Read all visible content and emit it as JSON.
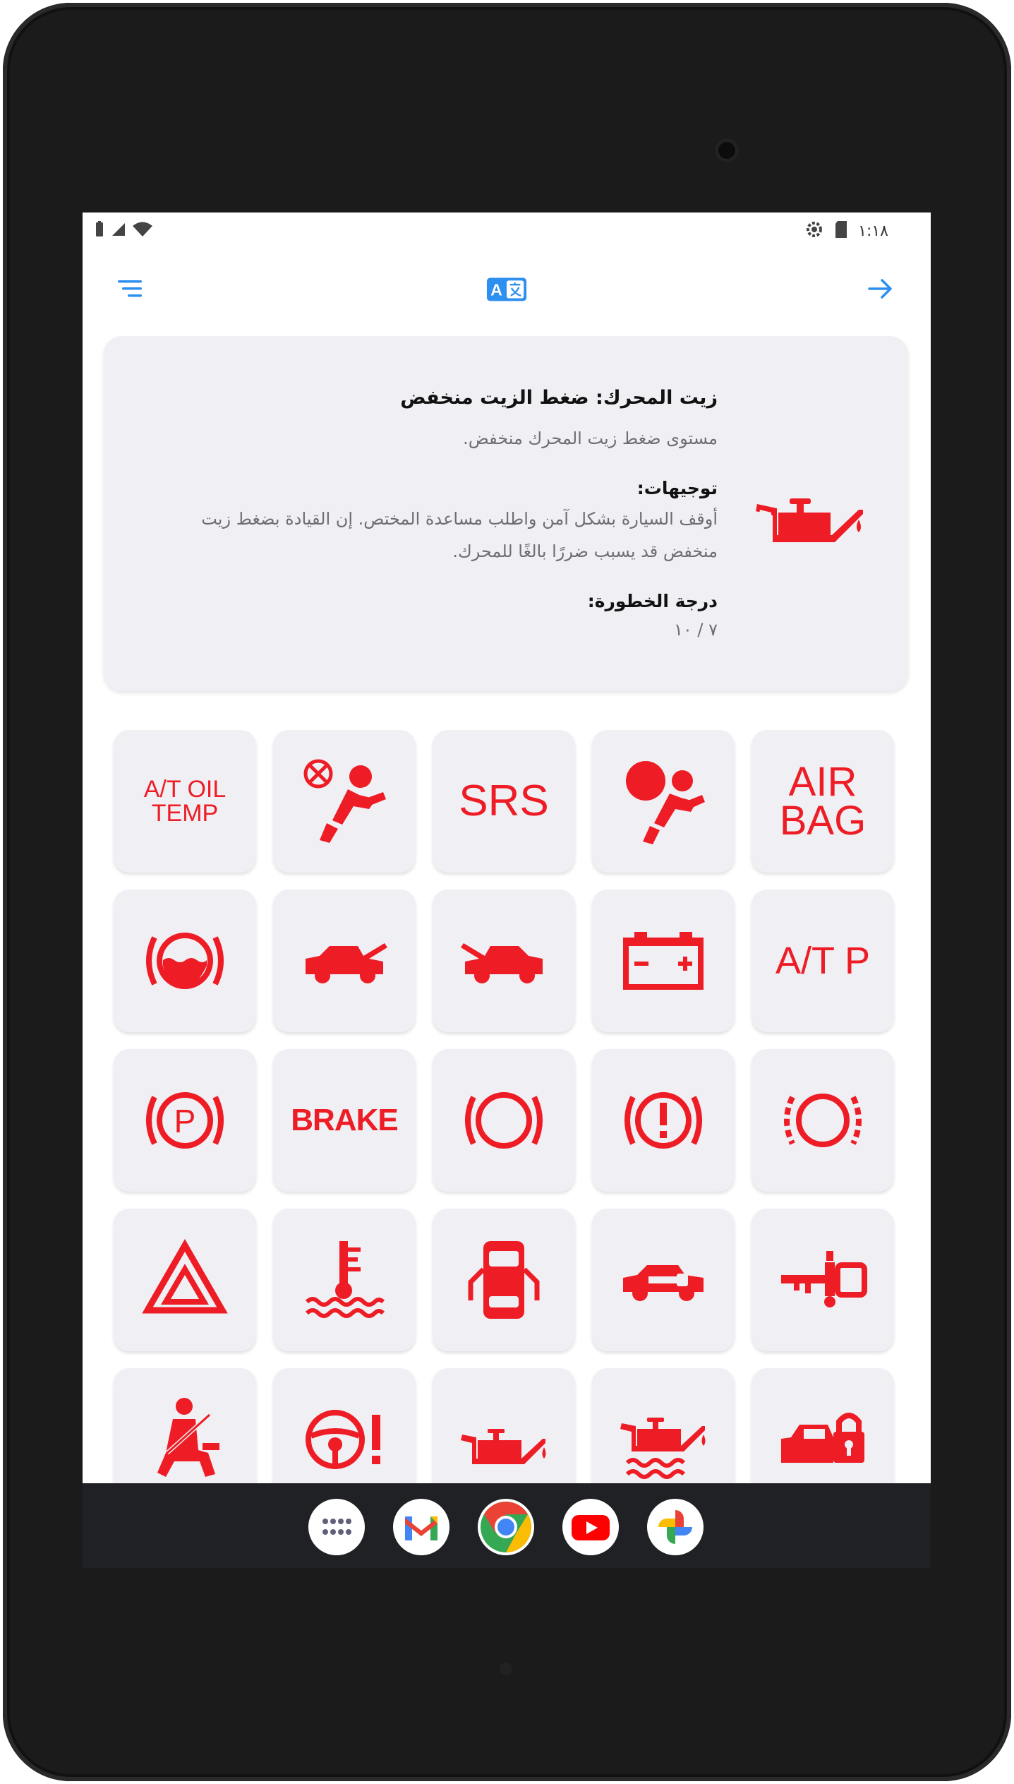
{
  "status_bar": {
    "time": "١:١٨"
  },
  "toolbar": {
    "menu_icon": "filter-list-icon",
    "translate_icon": "translate-icon",
    "forward_icon": "arrow-forward-icon"
  },
  "info_card": {
    "title": "زيت المحرك: ضغط الزيت منخفض",
    "description": "مستوى ضغط زيت المحرك منخفض.",
    "guidance_heading": "توجيهات:",
    "guidance_text": "أوقف السيارة بشكل آمن واطلب مساعدة المختص. إن القيادة بضغط زيت منخفض قد يسبب ضررًا بالغًا للمحرك.",
    "severity_heading": "درجة الخطورة:",
    "severity_value": "٧ / ١٠",
    "icon": "oil-can-icon"
  },
  "warning_grid": {
    "tiles": [
      {
        "kind": "text",
        "label": "A/T OIL TEMP"
      },
      {
        "kind": "icon",
        "icon": "airbag-off-icon"
      },
      {
        "kind": "text",
        "label": "SRS"
      },
      {
        "kind": "icon",
        "icon": "airbag-icon"
      },
      {
        "kind": "text",
        "label": "AIR BAG"
      },
      {
        "kind": "icon",
        "icon": "brake-fluid-level-icon"
      },
      {
        "kind": "icon",
        "icon": "hood-open-icon"
      },
      {
        "kind": "icon",
        "icon": "trunk-open-icon"
      },
      {
        "kind": "icon",
        "icon": "battery-icon"
      },
      {
        "kind": "text",
        "label": "A/T P"
      },
      {
        "kind": "icon",
        "icon": "parking-brake-icon"
      },
      {
        "kind": "text",
        "label": "BRAKE"
      },
      {
        "kind": "icon",
        "icon": "brake-circle-icon"
      },
      {
        "kind": "icon",
        "icon": "brake-warning-icon"
      },
      {
        "kind": "icon",
        "icon": "brake-pad-wear-icon"
      },
      {
        "kind": "icon",
        "icon": "hazard-triangle-icon"
      },
      {
        "kind": "icon",
        "icon": "coolant-temperature-icon"
      },
      {
        "kind": "icon",
        "icon": "door-open-icon"
      },
      {
        "kind": "icon",
        "icon": "car-key-icon"
      },
      {
        "kind": "icon",
        "icon": "immobilizer-key-icon"
      },
      {
        "kind": "icon",
        "icon": "seatbelt-icon"
      },
      {
        "kind": "icon",
        "icon": "steering-warning-icon"
      },
      {
        "kind": "icon",
        "icon": "oil-can-icon"
      },
      {
        "kind": "icon",
        "icon": "oil-level-icon"
      },
      {
        "kind": "icon",
        "icon": "car-lock-icon"
      }
    ]
  },
  "dock": {
    "apps": [
      "app-drawer-icon",
      "gmail-icon",
      "chrome-icon",
      "youtube-icon",
      "photos-icon"
    ]
  },
  "colors": {
    "accent": "#2d8ff0",
    "warning_red": "#ee1c25",
    "card_bg": "#efeff4"
  }
}
